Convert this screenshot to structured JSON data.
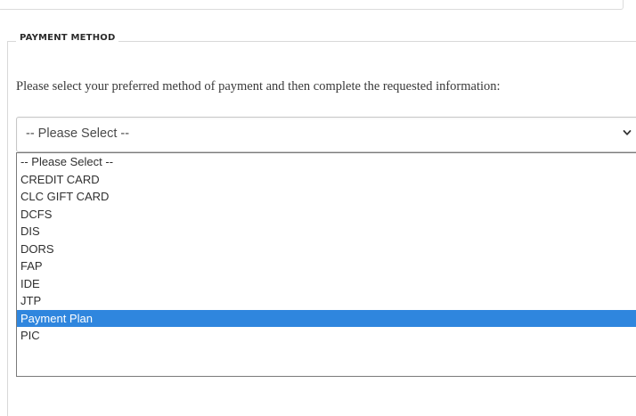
{
  "section": {
    "legend": "PAYMENT METHOD",
    "instructions": "Please select your preferred method of payment and then complete the requested information:"
  },
  "select": {
    "value": "-- Please Select --",
    "icon": "chevron-down-icon"
  },
  "dropdown": {
    "options": [
      "-- Please Select --",
      "CREDIT CARD",
      "CLC GIFT CARD",
      "DCFS",
      "DIS",
      "DORS",
      "FAP",
      "IDE",
      "JTP",
      "Payment Plan",
      "PIC"
    ],
    "highlighted_option": "Payment Plan",
    "highlight_color": "#2f86de"
  }
}
